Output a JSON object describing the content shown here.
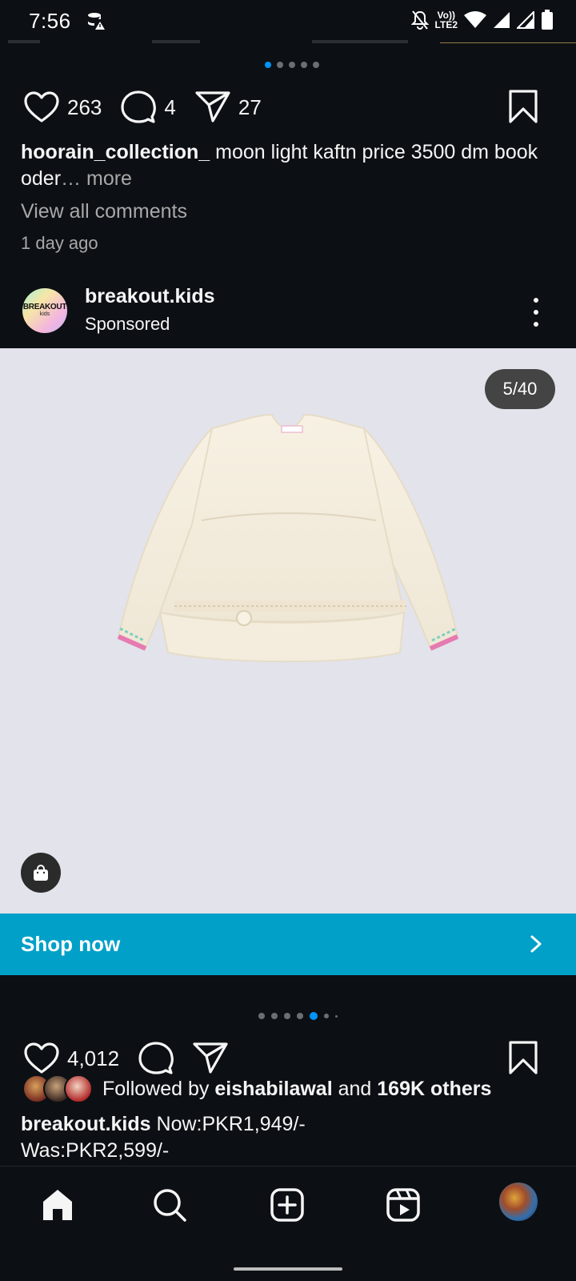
{
  "status_bar": {
    "time": "7:56",
    "volte_line1": "Vo))",
    "volte_line2": "LTE2"
  },
  "top_post": {
    "like_count": "263",
    "comment_count": "4",
    "share_count": "27",
    "username": "hoorain_collection_",
    "caption_text": "moon light kaftn price 3500 dm book oder",
    "more_label": "… more",
    "view_comments": "View all comments",
    "time_ago": "1 day ago"
  },
  "sponsored_post": {
    "avatar_text_line1": "BREAKOUT",
    "avatar_text_line2": "kids",
    "username": "breakout.kids",
    "sponsored_label": "Sponsored",
    "media_counter": "5/40",
    "shop_now_label": "Shop now",
    "like_count": "4,012",
    "followed_by_prefix": "Followed by",
    "followed_by_user": "eishabilawal",
    "followed_by_joiner": "and",
    "followed_by_others": "169K others",
    "caption_username": "breakout.kids",
    "caption_line1": "Now:PKR1,949/-",
    "caption_line2": "Was:PKR2,599/-"
  },
  "colors": {
    "background": "#0c1014",
    "accent_blue": "#0095f6",
    "shop_now_bar": "#00a0c8",
    "media_background": "#e3e3ec"
  },
  "icons": [
    "heart-icon",
    "comment-icon",
    "share-icon",
    "bookmark-icon",
    "more-options-icon",
    "shopping-bag-icon",
    "chevron-right-icon",
    "home-icon",
    "search-icon",
    "create-icon",
    "reels-icon"
  ]
}
